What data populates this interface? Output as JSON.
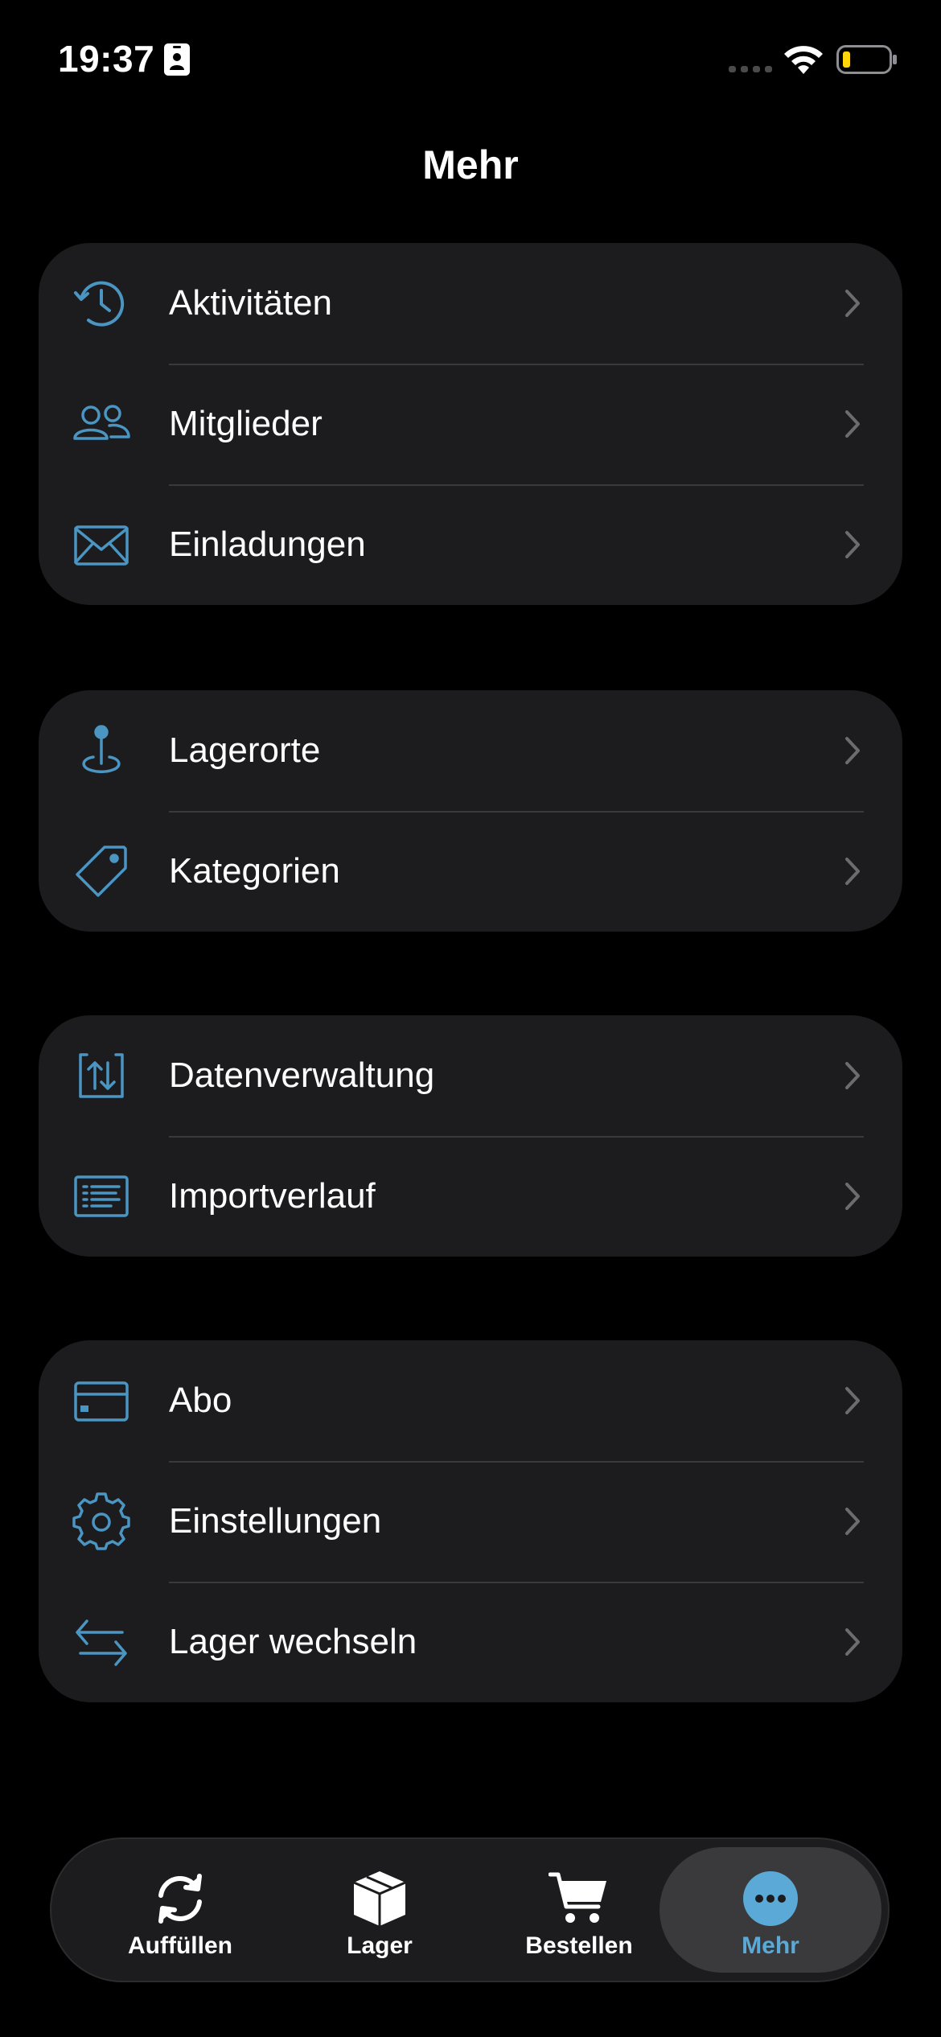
{
  "status_bar": {
    "time": "19:37"
  },
  "colors": {
    "accent": "#4a95c2",
    "active_tab": "#5aa9d6",
    "group_bg": "#1c1c1e",
    "battery_low": "#ffd60a"
  },
  "page": {
    "title": "Mehr"
  },
  "groups": [
    {
      "items": [
        {
          "label": "Aktivitäten",
          "icon": "history-icon"
        },
        {
          "label": "Mitglieder",
          "icon": "members-icon"
        },
        {
          "label": "Einladungen",
          "icon": "envelope-icon"
        }
      ]
    },
    {
      "items": [
        {
          "label": "Lagerorte",
          "icon": "location-pin-icon"
        },
        {
          "label": "Kategorien",
          "icon": "tag-icon"
        }
      ]
    },
    {
      "items": [
        {
          "label": "Datenverwaltung",
          "icon": "data-transfer-icon"
        },
        {
          "label": "Importverlauf",
          "icon": "list-icon"
        }
      ]
    },
    {
      "items": [
        {
          "label": "Abo",
          "icon": "credit-card-icon"
        },
        {
          "label": "Einstellungen",
          "icon": "gear-icon"
        },
        {
          "label": "Lager wechseln",
          "icon": "switch-arrows-icon"
        }
      ]
    }
  ],
  "tab_bar": {
    "tabs": [
      {
        "label": "Auffüllen",
        "icon": "refresh-icon",
        "active": false
      },
      {
        "label": "Lager",
        "icon": "box-icon",
        "active": false
      },
      {
        "label": "Bestellen",
        "icon": "cart-icon",
        "active": false
      },
      {
        "label": "Mehr",
        "icon": "more-icon",
        "active": true
      }
    ]
  }
}
